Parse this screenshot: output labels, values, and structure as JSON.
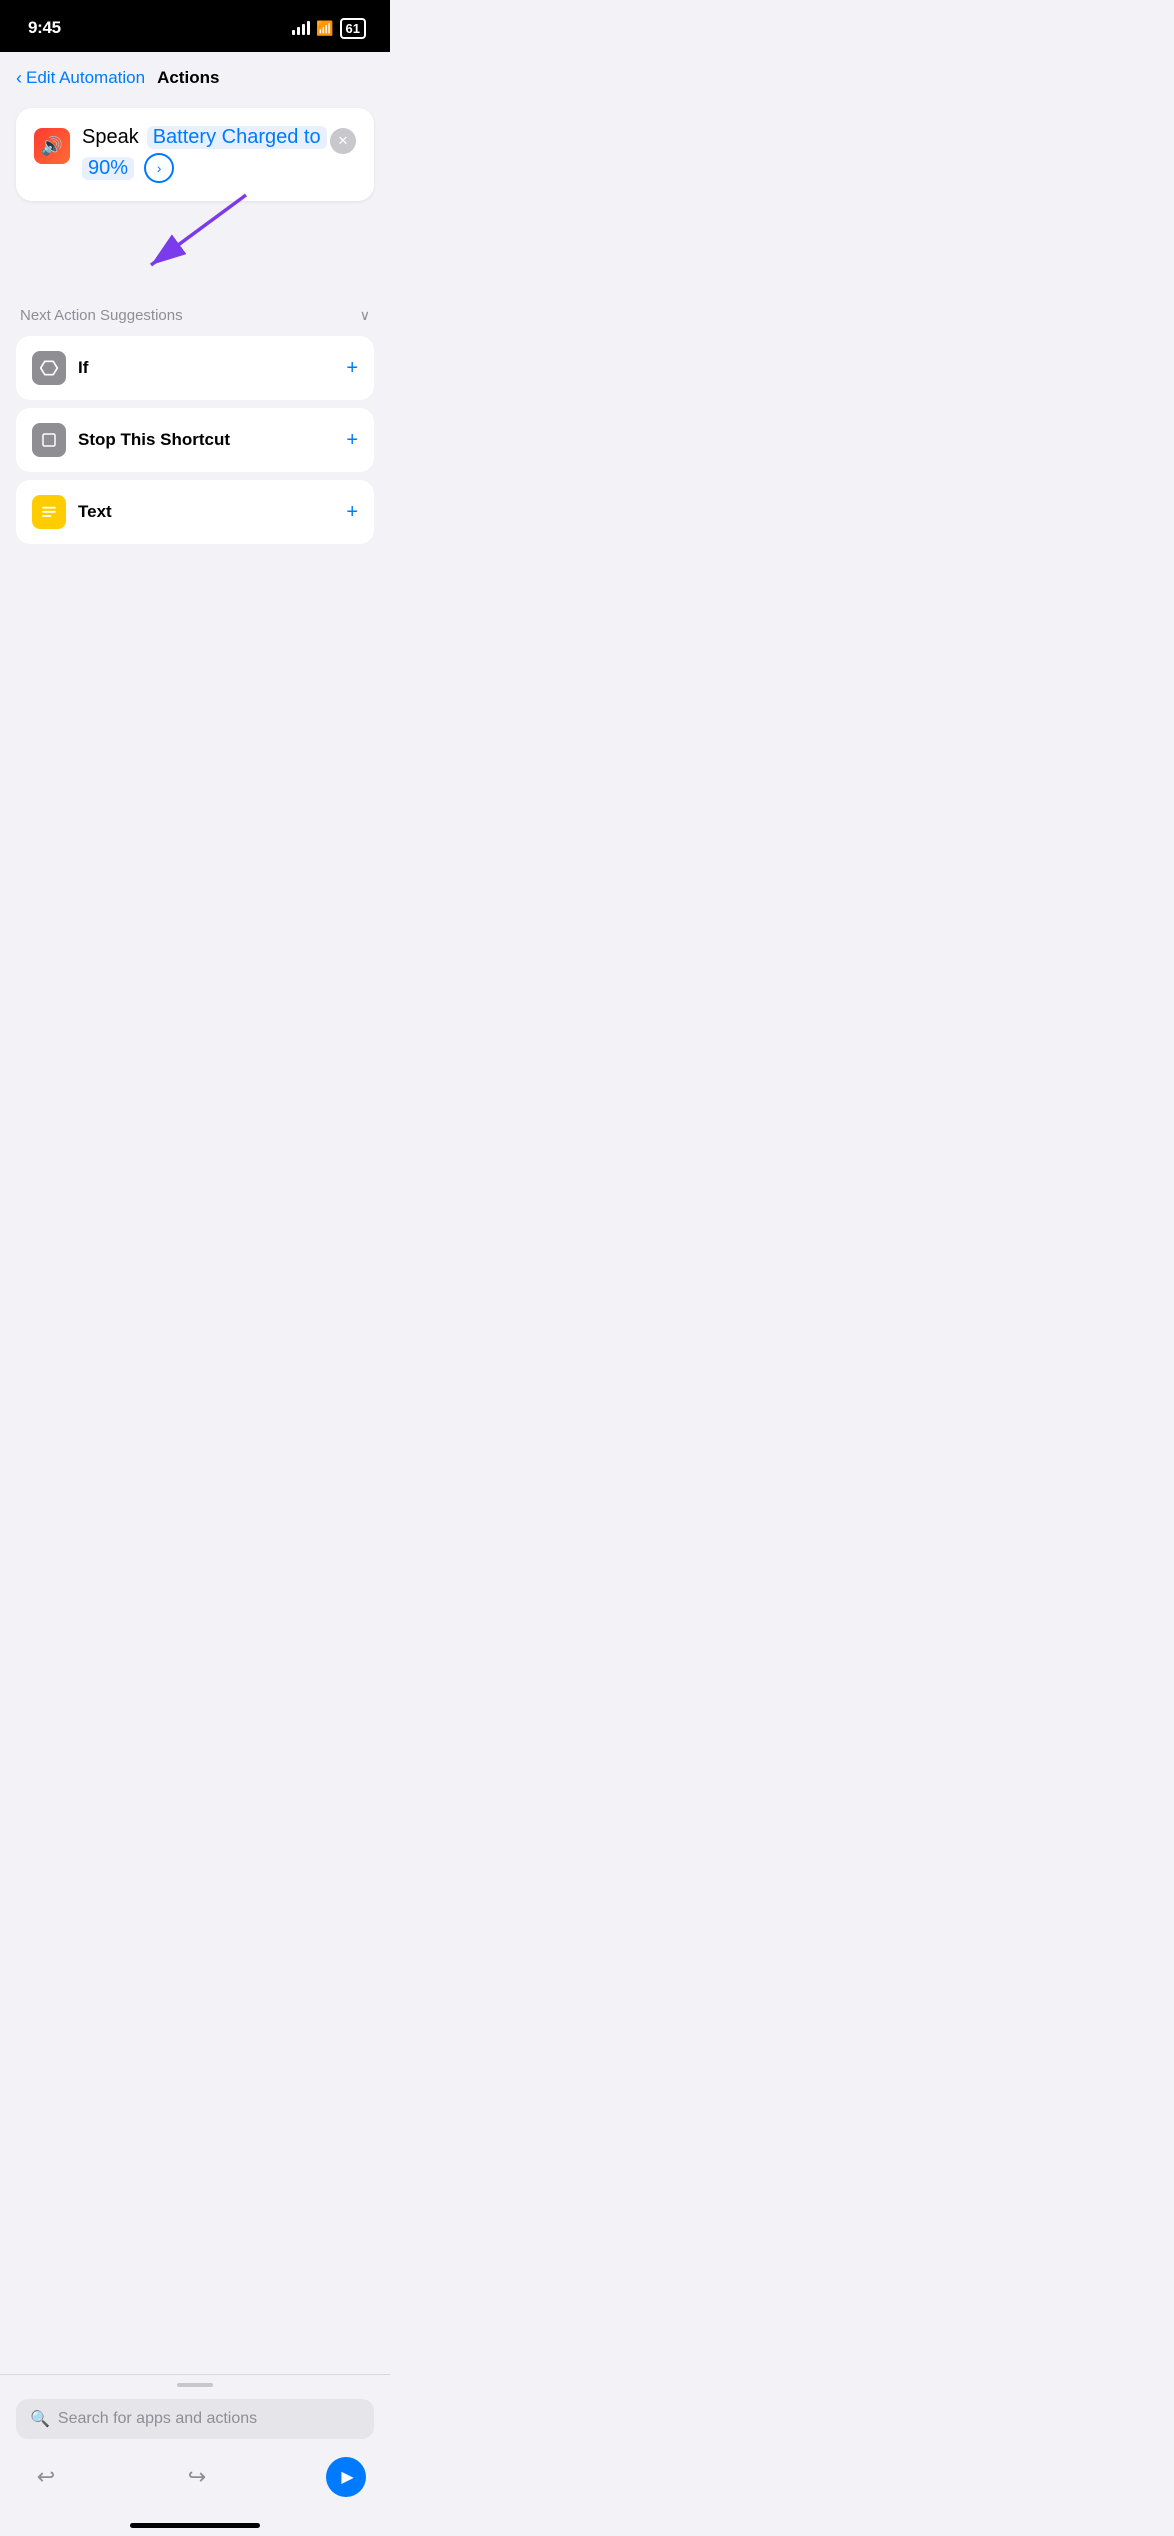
{
  "statusBar": {
    "time": "9:45",
    "battery": "61"
  },
  "navigation": {
    "backLabel": "Edit Automation",
    "title": "Actions"
  },
  "speakCard": {
    "word": "Speak",
    "highlightedText": "Battery Charged to",
    "percent": "90%"
  },
  "suggestions": {
    "headerLabel": "Next Action Suggestions",
    "items": [
      {
        "name": "If",
        "iconType": "gray"
      },
      {
        "name": "Stop This Shortcut",
        "iconType": "gray"
      },
      {
        "name": "Text",
        "iconType": "yellow"
      }
    ]
  },
  "searchBar": {
    "placeholder": "Search for apps and actions"
  },
  "toolbar": {
    "undoLabel": "undo",
    "redoLabel": "redo",
    "playLabel": "play"
  }
}
